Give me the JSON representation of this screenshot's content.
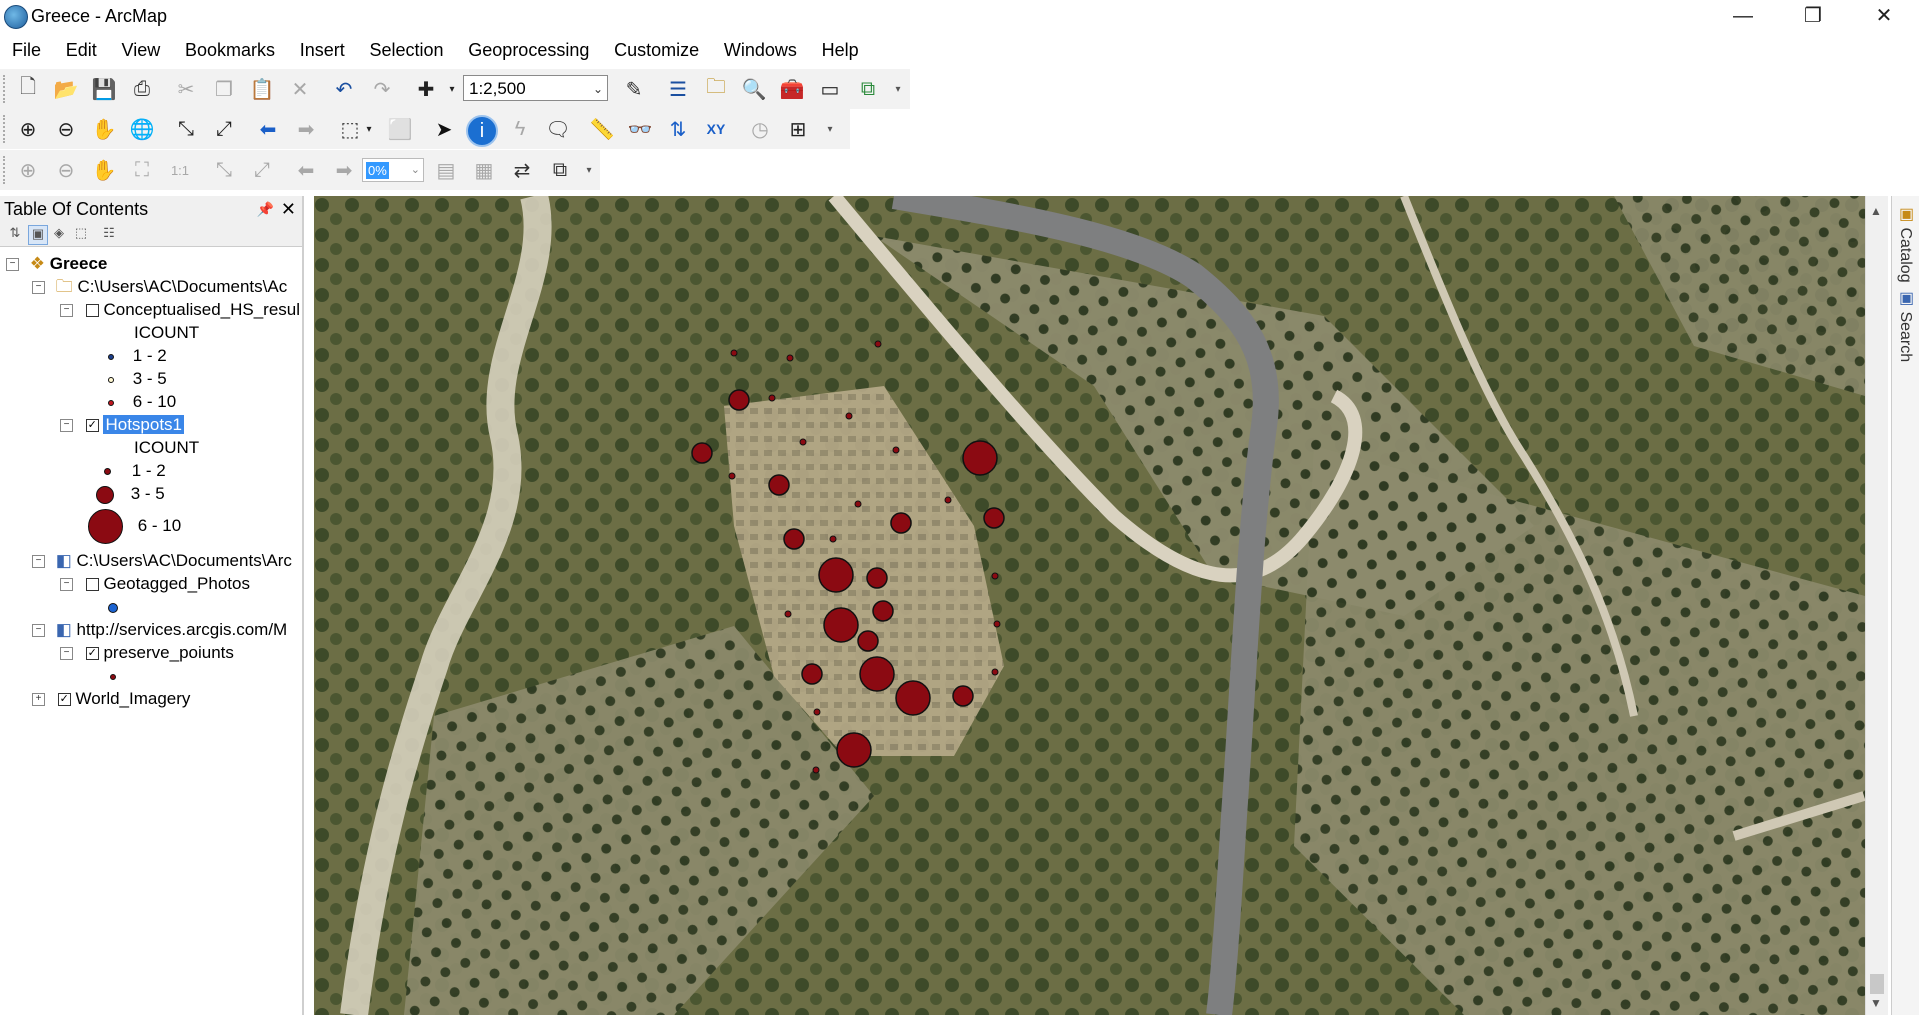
{
  "window": {
    "title": "Greece - ArcMap",
    "minimize": "—",
    "restore": "❐",
    "close": "✕"
  },
  "menu": [
    "File",
    "Edit",
    "View",
    "Bookmarks",
    "Insert",
    "Selection",
    "Geoprocessing",
    "Customize",
    "Windows",
    "Help"
  ],
  "toolbar": {
    "scale_value": "1:2,500",
    "percent_value": "0%"
  },
  "toc": {
    "title": "Table Of Contents",
    "rows": {
      "dataframe": "Greece",
      "folder1": "C:\\Users\\AC\\Documents\\Ac",
      "layer_conceptualised": "Conceptualised_HS_resul",
      "field1": "ICOUNT",
      "c_class1": "1 - 2",
      "c_class2": "3 - 5",
      "c_class3": "6 - 10",
      "layer_hotspots": "Hotspots1",
      "field2": "ICOUNT",
      "h_class1": "1 - 2",
      "h_class2": "3 - 5",
      "h_class3": "6 - 10",
      "folder2": "C:\\Users\\AC\\Documents\\Arc",
      "layer_geotagged": "Geotagged_Photos",
      "service": "http://services.arcgis.com/M",
      "layer_preserve": "preserve_poiunts",
      "layer_imagery": "World_Imagery"
    }
  },
  "right_dock": {
    "catalog": "Catalog",
    "search": "Search"
  },
  "colors": {
    "point_fill": "#8b0a12",
    "selection": "#3a86e8",
    "road": "#7e7f80"
  }
}
